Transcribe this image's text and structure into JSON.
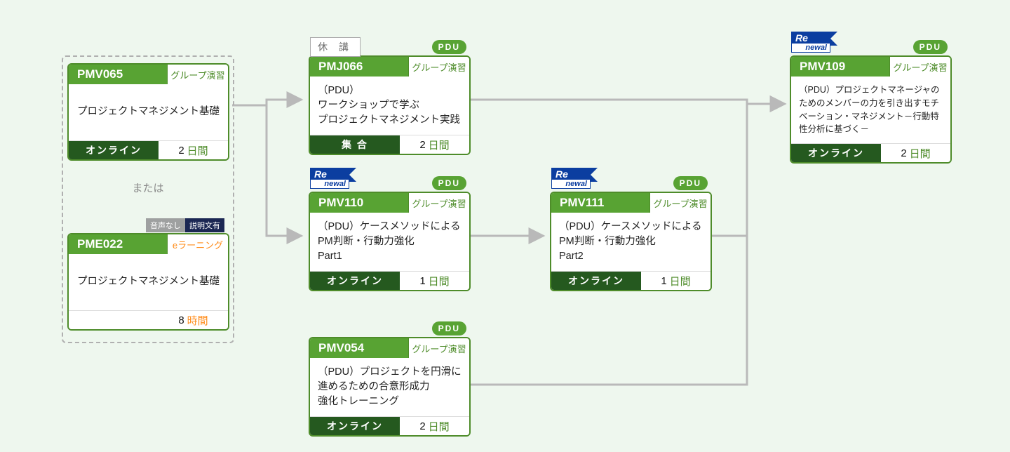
{
  "labels": {
    "or": "または",
    "pdu": "PDU",
    "suspended": "休 講",
    "renewal_top": "Re",
    "renewal_bottom": "newal",
    "pretag_noaudio": "音声なし",
    "pretag_hasdesc": "説明文有"
  },
  "cards": {
    "pmv065": {
      "code": "PMV065",
      "tag": "グループ演習",
      "title": "プロジェクトマネジメント基礎",
      "mode": "オンライン",
      "dur_n": "2",
      "dur_u": "日間"
    },
    "pme022": {
      "code": "PME022",
      "tag": "eラーニング",
      "title": "プロジェクトマネジメント基礎",
      "dur_n": "8",
      "dur_u": "時間"
    },
    "pmj066": {
      "code": "PMJ066",
      "tag": "グループ演習",
      "title": "（PDU）\nワークショップで学ぶ\nプロジェクトマネジメント実践",
      "mode": "集 合",
      "dur_n": "2",
      "dur_u": "日間"
    },
    "pmv110": {
      "code": "PMV110",
      "tag": "グループ演習",
      "title": "（PDU）ケースメソッドによる\nPM判断・行動力強化\nPart1",
      "mode": "オンライン",
      "dur_n": "1",
      "dur_u": "日間"
    },
    "pmv054": {
      "code": "PMV054",
      "tag": "グループ演習",
      "title": "（PDU）プロジェクトを円滑に\n進めるための合意形成力\n強化トレーニング",
      "mode": "オンライン",
      "dur_n": "2",
      "dur_u": "日間"
    },
    "pmv111": {
      "code": "PMV111",
      "tag": "グループ演習",
      "title": "（PDU）ケースメソッドによる\nPM判断・行動力強化\nPart2",
      "mode": "オンライン",
      "dur_n": "1",
      "dur_u": "日間"
    },
    "pmv109": {
      "code": "PMV109",
      "tag": "グループ演習",
      "title": "（PDU）プロジェクトマネージャのためのメンバーの力を引き出すモチベーション・マネジメント－行動特性分析に基づく－",
      "mode": "オンライン",
      "dur_n": "2",
      "dur_u": "日間"
    }
  }
}
